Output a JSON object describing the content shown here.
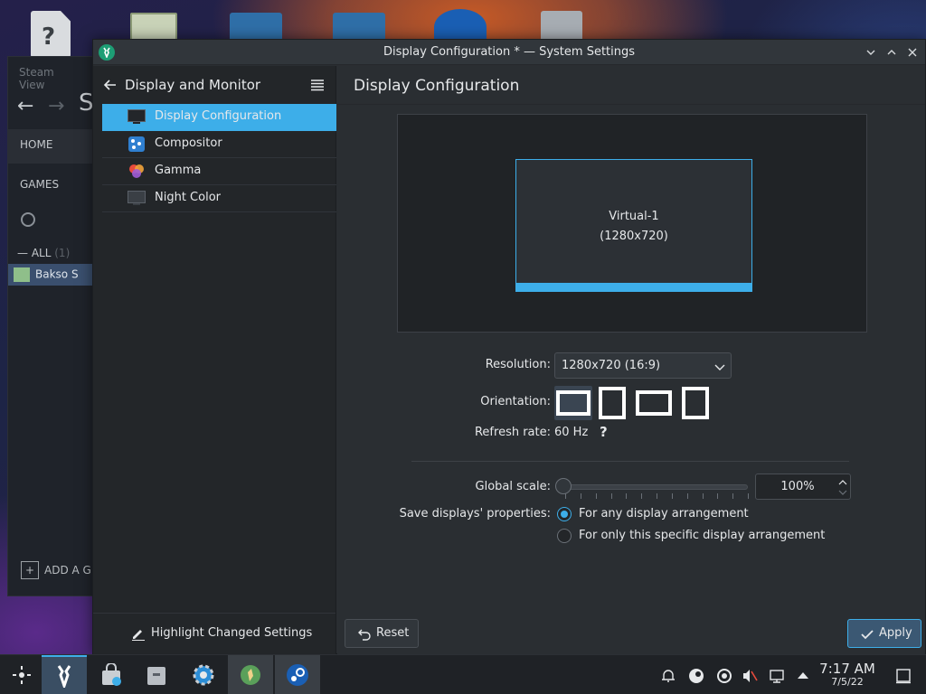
{
  "window": {
    "title": "Display Configuration * — System Settings"
  },
  "steam": {
    "menu": [
      "Steam",
      "View"
    ],
    "store_letter": "S",
    "home": "HOME",
    "games": "GAMES",
    "all": "ALL",
    "all_count": "(1)",
    "game_name": "Bakso S",
    "add_game": "ADD A G"
  },
  "sidebar": {
    "header": "Display and Monitor",
    "items": [
      {
        "label": "Display Configuration",
        "icon": "monitor-icon",
        "active": true
      },
      {
        "label": "Compositor",
        "icon": "compositor-icon"
      },
      {
        "label": "Gamma",
        "icon": "gamma-icon"
      },
      {
        "label": "Night Color",
        "icon": "night-color-icon"
      }
    ],
    "highlight_changed": "Highlight Changed Settings"
  },
  "content": {
    "title": "Display Configuration",
    "monitor": {
      "name": "Virtual-1",
      "resolution": "(1280x720)"
    },
    "resolution_label": "Resolution:",
    "resolution_value": "1280x720 (16:9)",
    "orientation_label": "Orientation:",
    "orientations": [
      "landscape",
      "portrait",
      "landscape-flipped",
      "portrait-flipped"
    ],
    "orientation_selected": 0,
    "refresh_label": "Refresh rate:",
    "refresh_value": "60 Hz",
    "help_glyph": "?",
    "scale_label": "Global scale:",
    "scale_value": "100%",
    "scale_fraction": 0.0,
    "save_label": "Save displays' properties:",
    "save_options": [
      {
        "label": "For any display arrangement",
        "checked": true
      },
      {
        "label": "For only this specific display arrangement",
        "checked": false
      }
    ],
    "reset_label": "Reset",
    "apply_label": "Apply"
  },
  "taskbar": {
    "time": "7:17 AM",
    "date": "7/5/22"
  },
  "colors": {
    "accent": "#3daee9",
    "window_bg": "#2a2e32",
    "sidebar_bg": "#232629"
  }
}
